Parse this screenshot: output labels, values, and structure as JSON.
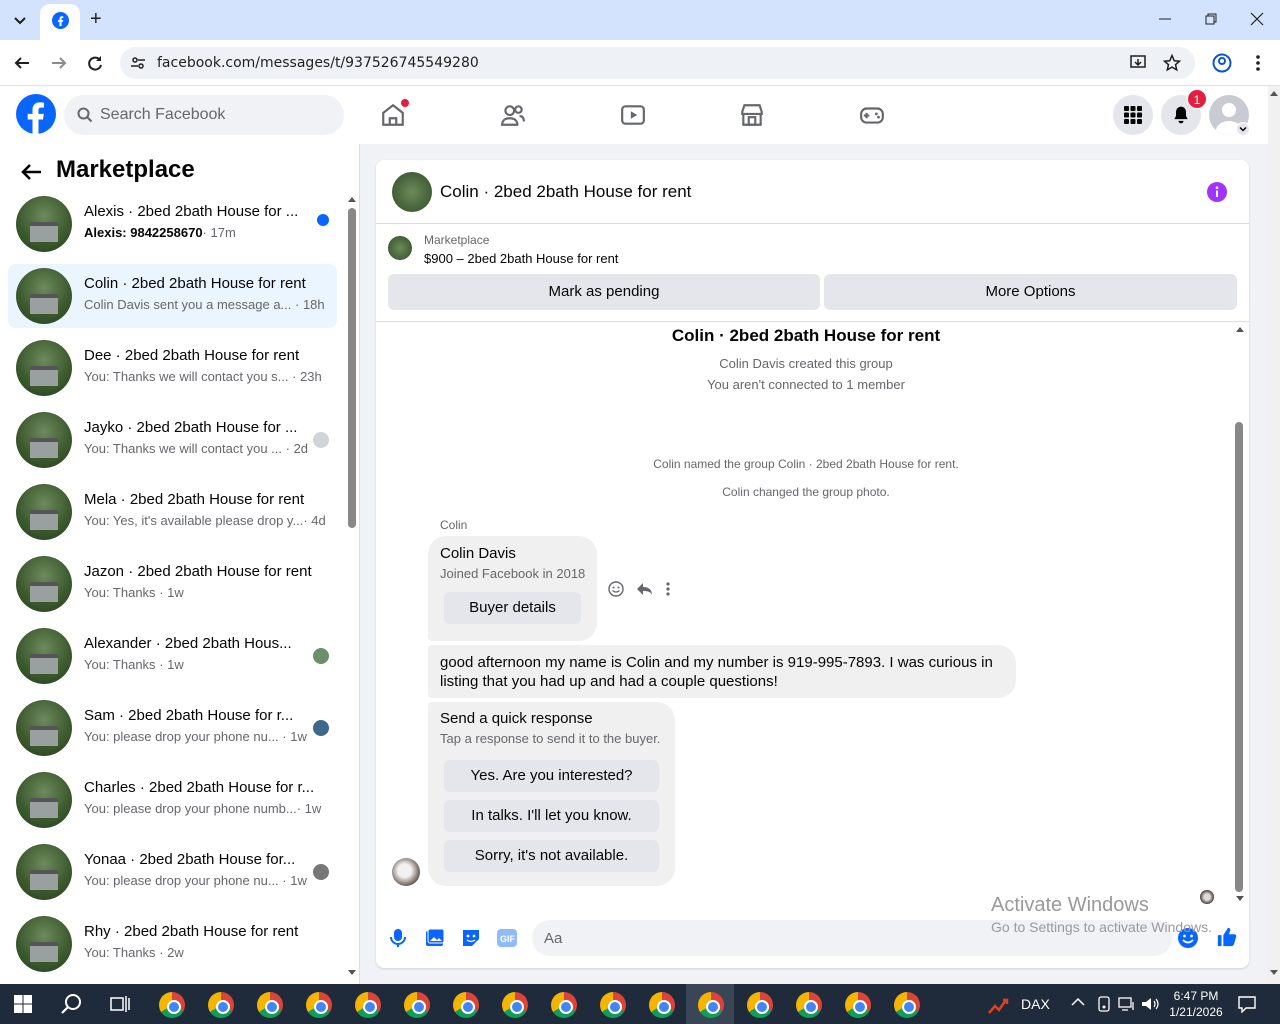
{
  "browser": {
    "url": "facebook.com/messages/t/937526745549280",
    "tab_favicon": "facebook-icon",
    "new_tab": "+"
  },
  "header": {
    "search_placeholder": "Search Facebook",
    "notification_count": "1"
  },
  "sidebar": {
    "title": "Marketplace",
    "conversations": [
      {
        "title": "Alexis · 2bed 2bath House for ...",
        "snippet": "Alexis: 9842258670",
        "time": "· 17m",
        "unread": true
      },
      {
        "title": "Colin · 2bed 2bath House for rent",
        "snippet": "Colin Davis sent you a message a...",
        "time": "· 18h",
        "selected": true
      },
      {
        "title": "Dee · 2bed 2bath House for rent",
        "snippet": "You: Thanks we will contact you s...",
        "time": "· 23h"
      },
      {
        "title": "Jayko · 2bed 2bath House for ...",
        "snippet": "You: Thanks we will contact you ...",
        "time": "· 2d"
      },
      {
        "title": "Mela · 2bed 2bath House for rent",
        "snippet": "You: Yes, it's available please drop y...",
        "time": "· 4d"
      },
      {
        "title": "Jazon · 2bed 2bath House for rent",
        "snippet": "You: Thanks",
        "time": "· 1w"
      },
      {
        "title": "Alexander · 2bed 2bath Hous...",
        "snippet": "You: Thanks",
        "time": "· 1w"
      },
      {
        "title": "Sam · 2bed 2bath House for r...",
        "snippet": "You: please drop your phone nu...",
        "time": "· 1w"
      },
      {
        "title": "Charles · 2bed 2bath House for r...",
        "snippet": "You: please drop your phone numb...",
        "time": "· 1w"
      },
      {
        "title": "Yonaa · 2bed 2bath House for...",
        "snippet": "You: please drop your phone nu...",
        "time": "· 1w"
      },
      {
        "title": "Rhy · 2bed 2bath House for rent",
        "snippet": "You: Thanks",
        "time": "· 2w"
      }
    ]
  },
  "chat": {
    "title": "Colin · 2bed 2bath House for rent",
    "marketplace_label": "Marketplace",
    "listing": "$900 – 2bed 2bath House for rent",
    "mark_pending": "Mark as pending",
    "more_options": "More Options",
    "group_title": "Colin · 2bed 2bath House for rent",
    "created": "Colin Davis created this group",
    "not_connected": "You aren't connected to 1 member",
    "named": "Colin named the group Colin · 2bed 2bath House for rent.",
    "changed_photo": "Colin changed the group photo.",
    "sender": "Colin",
    "card_name": "Colin Davis",
    "card_joined": "Joined Facebook in 2018",
    "buyer_details": "Buyer details",
    "message": "good afternoon my name is Colin and my number is 919-995-7893. I was curious in listing that you had up and had a couple questions!",
    "quick_title": "Send a quick response",
    "quick_sub": "Tap a response to send it to the buyer.",
    "quick_1": "Yes. Are you interested?",
    "quick_2": "In talks. I'll let you know.",
    "quick_3": "Sorry, it's not available.",
    "composer_placeholder": "Aa"
  },
  "watermark": {
    "line1": "Activate Windows",
    "line2": "Go to Settings to activate Windows."
  },
  "taskbar": {
    "dax": "DAX",
    "time": "6:47 PM",
    "date": "1/21/2026"
  },
  "colors": {
    "accent": "#0866ff",
    "badge": "#e41e3f",
    "info": "#a033ff"
  }
}
